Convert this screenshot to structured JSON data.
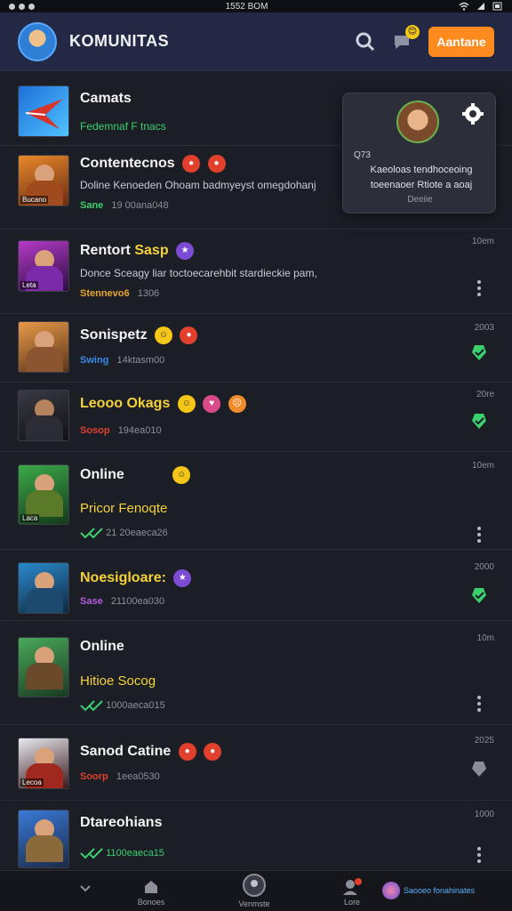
{
  "status_bar": {
    "time": "1552 BOM"
  },
  "header": {
    "title": "KOMUNITAS",
    "add_label": "Aantane",
    "notif_badge": "😊"
  },
  "popup": {
    "code": "Q73",
    "text": "Kaeoloas tendhoceoing toeenaoer Rtiote a aoaj",
    "footer": "Deeiie"
  },
  "rows": [
    {
      "title": "Camats",
      "desc": "Fedemnaf F tnacs",
      "time": ""
    },
    {
      "title": "Contentecnos",
      "desc": "Doline Kenoeden Ohoam badmyeyst omegdohanj",
      "meta_tag": "Sane",
      "meta": "19 00ana048",
      "thumb_tag": "Bucano"
    },
    {
      "title": "Rentort",
      "title_hl": "Sasp",
      "desc": "Donce Sceagy liar toctoecarehbit stardieckie pam,",
      "meta_tag": "Stennevo6",
      "meta": "1306",
      "time": "10em",
      "thumb_tag": "Leta"
    },
    {
      "title": "Sonispetz",
      "meta_tag": "Swing",
      "meta": "14ktasm00",
      "time": "2003"
    },
    {
      "title": "Leooo Okags",
      "meta_tag": "Sosop",
      "meta": "194ea010",
      "time": "20re"
    },
    {
      "title": "Online",
      "sub": "Pricor Fenoqte",
      "meta": "21 20eaeca26",
      "time": "10em",
      "thumb_tag": "Laca"
    },
    {
      "title": "Noesigloare:",
      "meta_tag": "Sase",
      "meta": "21100ea030",
      "time": "2000"
    },
    {
      "title": "Online",
      "sub": "Hitioe Socog",
      "meta": "1000aeca015",
      "time": "10m"
    },
    {
      "title": "Sanod Catine",
      "meta_tag": "Soorp",
      "meta": "1eea0530",
      "time": "2025",
      "thumb_tag": "Lecoa"
    },
    {
      "title": "Dtareohians",
      "meta": "1100eaeca15",
      "time": "1000"
    }
  ],
  "bottom_nav": {
    "items": [
      "Bonoes",
      "Venmste",
      "Lore"
    ],
    "profile_text": "Saooeo fonahinates"
  },
  "colors": {
    "accent": "#ff8a1f",
    "header_bg": "#232845",
    "highlight": "#f5d23a",
    "check": "#3bcf6e"
  }
}
